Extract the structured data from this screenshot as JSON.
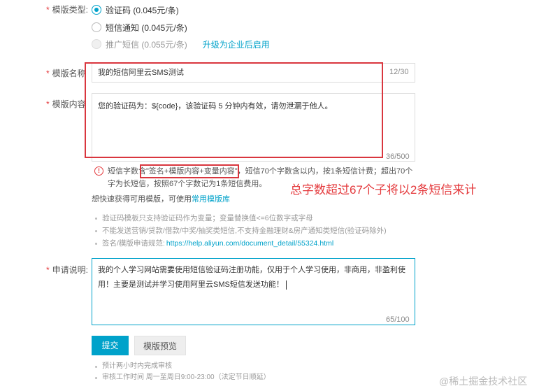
{
  "template_type": {
    "label": "模版类型:",
    "options": [
      {
        "label": "验证码 (0.045元/条)",
        "checked": true,
        "disabled": false
      },
      {
        "label": "短信通知 (0.045元/条)",
        "checked": false,
        "disabled": false
      },
      {
        "label": "推广短信 (0.055元/条)",
        "checked": false,
        "disabled": true
      }
    ],
    "upgrade_link": "升级为企业后启用"
  },
  "template_name": {
    "label": "模版名称",
    "value": "我的短信阿里云SMS测试",
    "counter": "12/30"
  },
  "template_content": {
    "label": "模版内容",
    "value": "您的验证码为：${code}，该验证码 5 分钟内有效，请勿泄漏于他人。",
    "counter": "36/500"
  },
  "notice": {
    "icon": "!",
    "prefix": "短信字数含",
    "highlight": "\"签名+模版内容+变量内容\"",
    "suffix": "，短信70个字数含以内，按1条短信计费；超出70个",
    "line2": "字为长短信，按照67个字数记为1条短信费用。",
    "quick_prefix": "想快速获得可用模版，可使用",
    "quick_link": "常用模版库"
  },
  "annotation": "总字数超过67个子将以2条短信来计",
  "tips": [
    "验证码模板只支持验证码作为变量；变量替换值<=6位数字或字母",
    "不能发送营销/贷款/借款/中奖/抽奖类短信,不支持金融理财&房产通知类短信(验证码除外)",
    "签名/模版申请规范:"
  ],
  "tips_link": "https://help.aliyun.com/document_detail/55324.html",
  "application": {
    "label": "申请说明:",
    "value_line1": "我的个人学习网站需要使用短信验证码注册功能，仅用于个人学习使用，非商用，非盈利使",
    "value_line2": "用！主要是测试并学习使用阿里云SMS短信发送功能！",
    "counter": "65/100"
  },
  "buttons": {
    "submit": "提交",
    "preview": "模版预览"
  },
  "footer": [
    "预计两小时内完成审核",
    "审核工作时间 周一至周日9:00-23:00（法定节日顺延）"
  ],
  "watermark": "@稀土掘金技术社区",
  "colors": {
    "accent": "#00a2ca",
    "annotation_red": "#d9363e"
  }
}
